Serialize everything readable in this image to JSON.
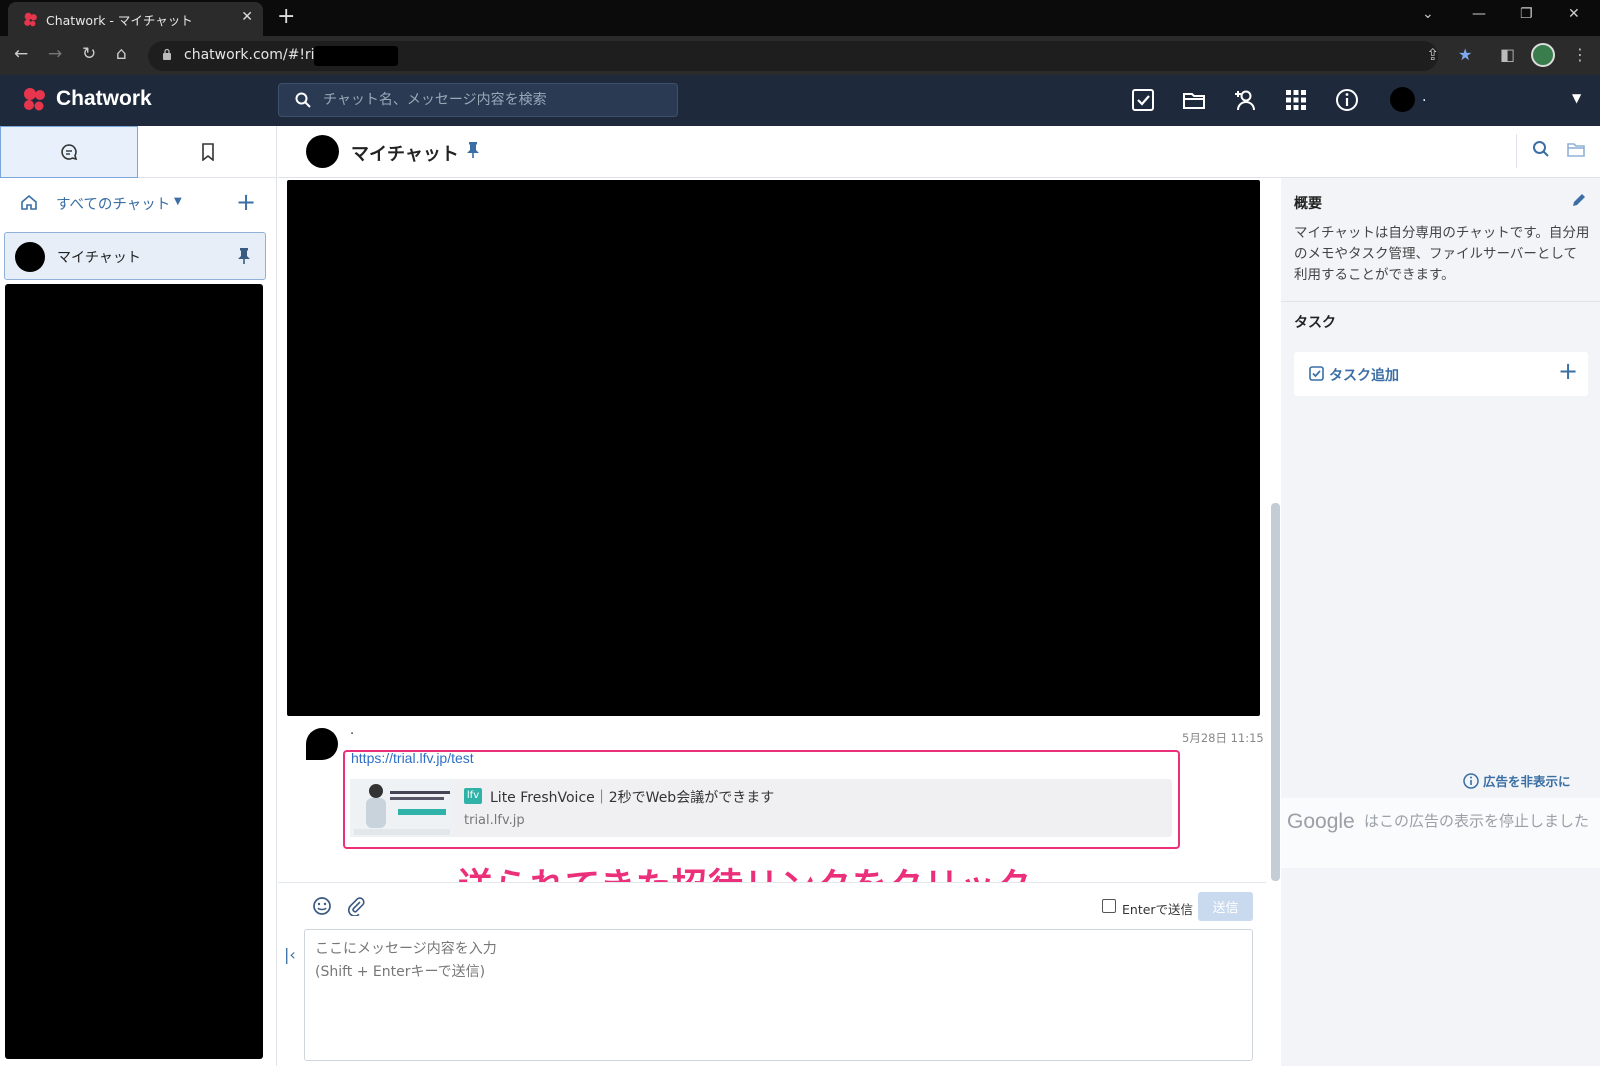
{
  "browser": {
    "tab_title": "Chatwork - マイチャット",
    "url": "chatwork.com/#!rid",
    "new_tab": "+"
  },
  "app": {
    "logo": "Chatwork",
    "search_placeholder": "チャット名、メッセージ内容を検索",
    "user_name": "."
  },
  "sidebar": {
    "all_chats_label": "すべてのチャット",
    "items": [
      {
        "label": "マイチャット",
        "pinned": true
      }
    ]
  },
  "room": {
    "title": "マイチャット"
  },
  "message": {
    "sender": ".",
    "time": "5月28日 11:15",
    "link": "https://trial.lfv.jp/test",
    "preview": {
      "title": "Lite FreshVoice｜2秒でWeb会議ができます",
      "domain": "trial.lfv.jp",
      "logo": "lfv"
    }
  },
  "annotation": "送られてきた招待リンクをクリック",
  "composer": {
    "enter_send_label": "Enterで送信",
    "send_label": "送信",
    "placeholder": "ここにメッセージ内容を入力\n(Shift + Enterキーで送信)"
  },
  "right_panel": {
    "summary_title": "概要",
    "summary_text": "マイチャットは自分専用のチャットです。自分用のメモやタスク管理、ファイルサーバーとして利用することができます。",
    "task_title": "タスク",
    "task_add_label": "タスク追加",
    "ad_hide_label": "広告を非表示に",
    "ad_google": "Google",
    "ad_message": "はこの広告の表示を停止しました"
  },
  "colors": {
    "header_bg": "#1e2a3b",
    "accent": "#3a6ea5",
    "annotation": "#ec2f7a"
  }
}
